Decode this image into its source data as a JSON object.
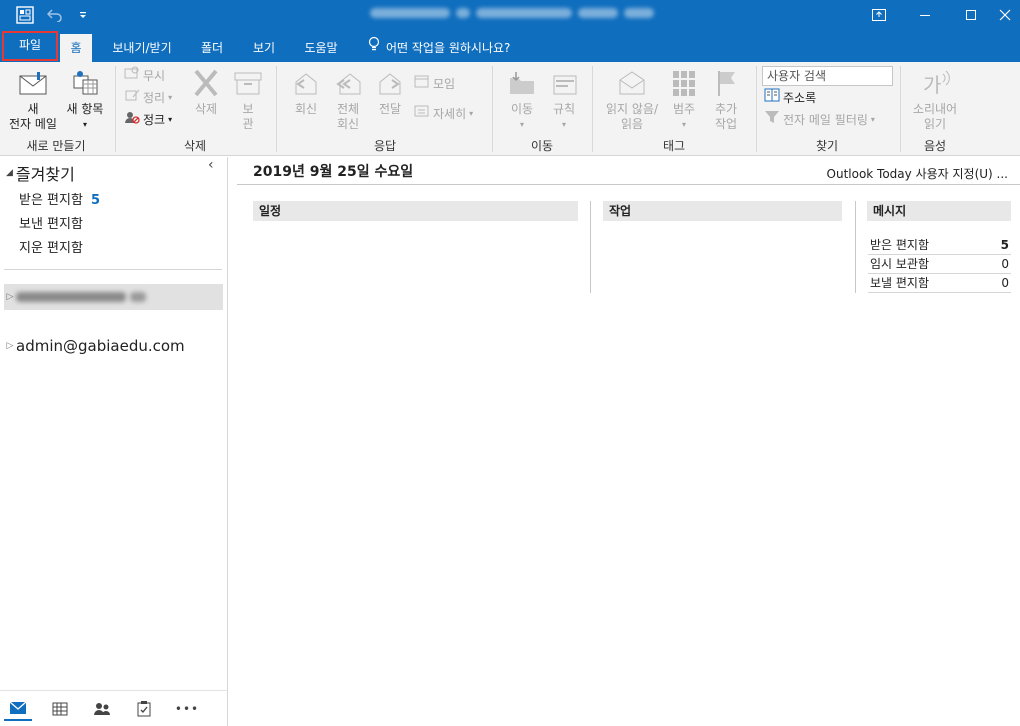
{
  "titlebar": {
    "title_blurred": true,
    "icons": [
      "outlook-app-icon",
      "undo-icon",
      "qat-dropdown-icon"
    ],
    "controls": [
      "ribbon-display-options-icon",
      "minimize-icon",
      "maximize-icon",
      "close-icon"
    ]
  },
  "tabs": {
    "file": "파일",
    "home": "홈",
    "send_receive": "보내기/받기",
    "folder": "폴더",
    "view": "보기",
    "help": "도움말",
    "tell_me": "어떤 작업을 원하시나요?"
  },
  "ribbon": {
    "new_group": {
      "label": "새로 만들기",
      "new_mail_line1": "새",
      "new_mail_line2": "전자 메일",
      "new_items": "새 항목"
    },
    "delete_group": {
      "label": "삭제",
      "ignore": "무시",
      "cleanup": "정리",
      "junk": "정크",
      "delete": "삭제",
      "archive_line1": "보",
      "archive_line2": "관"
    },
    "respond_group": {
      "label": "응답",
      "reply": "회신",
      "reply_all_line1": "전체",
      "reply_all_line2": "회신",
      "forward": "전달",
      "meeting": "모임",
      "more": "자세히"
    },
    "move_group": {
      "label": "이동",
      "move": "이동",
      "rules": "규칙"
    },
    "tags_group": {
      "label": "태그",
      "unread_read_line1": "읽지 않음/",
      "unread_read_line2": "읽음",
      "categorize": "범주",
      "followup_line1": "추가",
      "followup_line2": "작업"
    },
    "find_group": {
      "label": "찾기",
      "search_people_placeholder": "사용자 검색",
      "address_book": "주소록",
      "filter_email": "전자 메일 필터링"
    },
    "speech_group": {
      "label": "음성",
      "read_aloud_line1": "소리내어",
      "read_aloud_line2": "읽기"
    }
  },
  "folder_pane": {
    "favorites_title": "즐겨찾기",
    "favorites": [
      {
        "name": "받은 편지함",
        "count": "5"
      },
      {
        "name": "보낸 편지함",
        "count": ""
      },
      {
        "name": "지운 편지함",
        "count": ""
      }
    ],
    "accounts": [
      {
        "name": "",
        "blurred": true,
        "selected": true
      },
      {
        "name": "admin@gabiaedu.com",
        "blurred": false,
        "selected": false
      }
    ]
  },
  "navbar": {
    "icons": [
      "mail-icon",
      "calendar-icon",
      "people-icon",
      "tasks-icon",
      "more-icon"
    ],
    "more_label": "•••"
  },
  "main": {
    "date": "2019년 9월 25일 수요일",
    "customize": "Outlook Today 사용자 지정(U) ...",
    "calendar_header": "일정",
    "tasks_header": "작업",
    "messages_header": "메시지",
    "messages": [
      {
        "name": "받은 편지함",
        "count": "5",
        "bold": true
      },
      {
        "name": "임시 보관함",
        "count": "0",
        "bold": false
      },
      {
        "name": "보낼 편지함",
        "count": "0",
        "bold": false
      }
    ]
  },
  "colors": {
    "accent": "#106ebe",
    "highlight_border": "#e53935"
  }
}
